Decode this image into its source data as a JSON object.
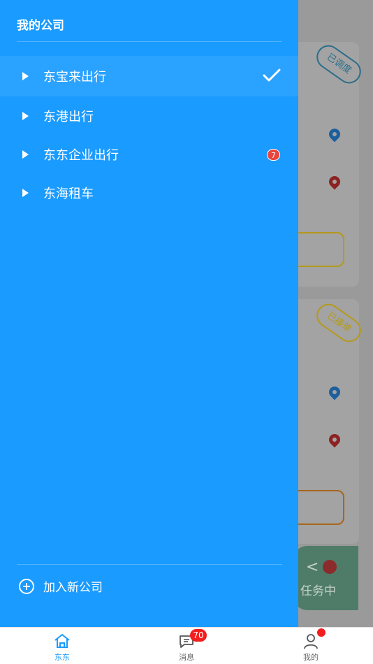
{
  "drawer": {
    "title": "我的公司",
    "companies": [
      {
        "name": "东宝来出行",
        "selected": true
      },
      {
        "name": "东港出行"
      },
      {
        "name": "东东企业出行",
        "badge": "7"
      },
      {
        "name": "东海租车"
      }
    ],
    "add_label": "加入新公司"
  },
  "background": {
    "stamp_1": "已调度",
    "stamp_2": "已接单",
    "task_label": "任务中"
  },
  "tabbar": {
    "tabs": [
      {
        "label": "东东",
        "icon": "home-icon",
        "active": true
      },
      {
        "label": "消息",
        "icon": "message-icon",
        "badge": "70"
      },
      {
        "label": "我的",
        "icon": "user-icon"
      }
    ]
  },
  "colors": {
    "drawer_bg": "#1a9bff",
    "accent": "#1a9bff",
    "badge_red": "#f21d1d"
  }
}
